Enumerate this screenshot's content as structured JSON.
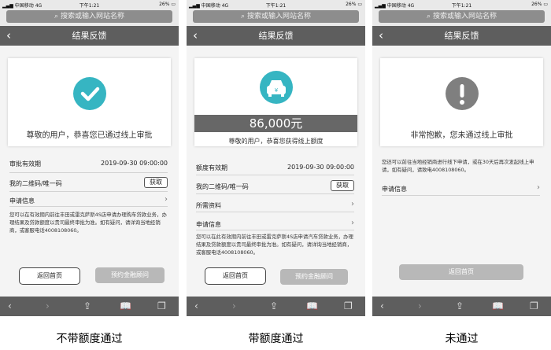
{
  "status": {
    "carrier": "中国移动",
    "network": "4G",
    "time": "下午1:21",
    "battery": "26%"
  },
  "search_placeholder": "搜索或输入网站名称",
  "panels": [
    {
      "title": "结果反馈",
      "message": "尊敬的用户，恭喜您已通过线上审批",
      "rows": {
        "validity_label": "审批有效期",
        "validity_value": "2019-09-30 09:00:00",
        "qr_label": "我的二维码/唯一码",
        "qr_button": "获取",
        "apply_info": "申请信息"
      },
      "notice": "您可以在有效期内前往丰田或雷克萨斯4S店申请办理购车贷款业务，办理结果及贷款额度以贵司最终审批为准。如有疑问，请详询当地经销商，或客服电话4008108060。",
      "home_button": "返回首页",
      "advisor_button": "预约金融顾问",
      "caption": "不带额度通过"
    },
    {
      "title": "结果反馈",
      "amount": "86,000元",
      "message": "尊敬的用户，恭喜您获得线上额度",
      "rows": {
        "validity_label": "额度有效期",
        "validity_value": "2019-09-30 09:00:00",
        "qr_label": "我的二维码/唯一码",
        "qr_button": "获取",
        "required_docs": "所需资料",
        "apply_info": "申请信息"
      },
      "notice": "您可以在此有效期内前往丰田或雷克萨斯4S店申请汽车贷款业务，办理结果及贷款额度以贵司最终审批为准。如有疑问，请详询当地经销商，或客服电话4008108060。",
      "home_button": "返回首页",
      "advisor_button": "预约金融顾问",
      "caption": "带额度通过"
    },
    {
      "title": "结果反馈",
      "message": "非常抱歉，您未通过线上审批",
      "notice": "您还可以前往当地经销商进行线下申请，或在30天后再次发起线上申请，如有疑问，请致电4008108060。",
      "rows": {
        "apply_info": "申请信息"
      },
      "home_button": "返回首页",
      "caption": "未通过"
    }
  ],
  "toolbar_icons": [
    "back-arrow-icon",
    "forward-arrow-icon",
    "share-icon",
    "bookmarks-icon",
    "tabs-icon"
  ],
  "colors": {
    "accent_teal": "#36b5c2",
    "nav_gray": "#5e5e5e"
  }
}
